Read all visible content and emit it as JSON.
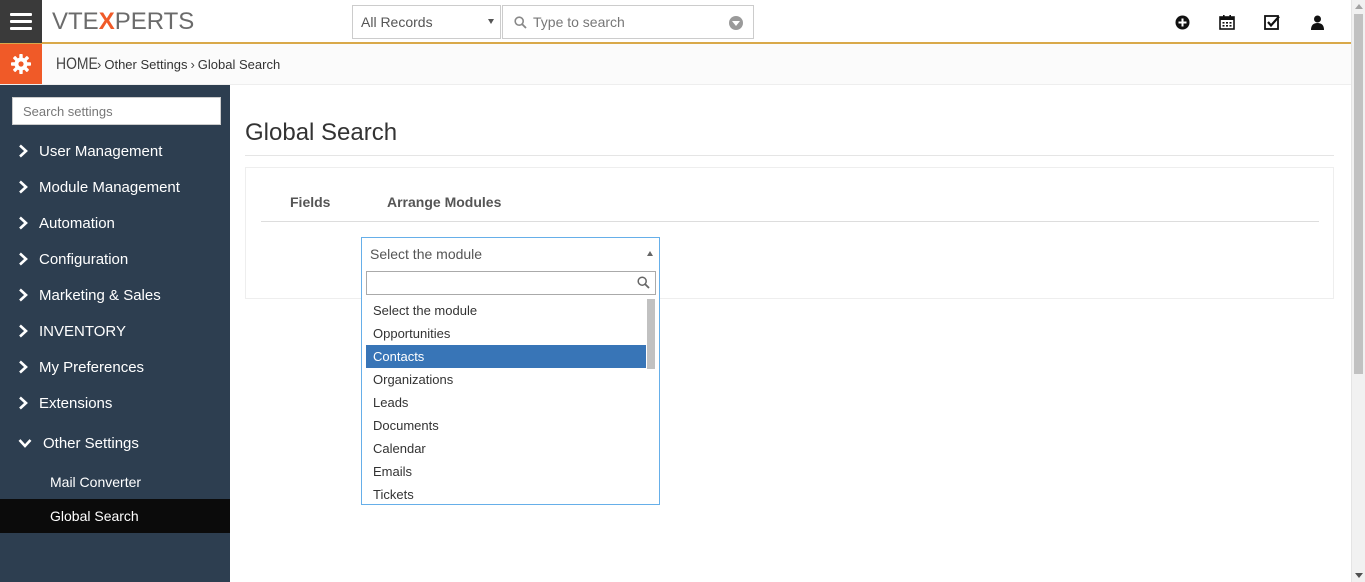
{
  "topbar": {
    "logo": {
      "pre": "VTE",
      "x": "X",
      "post": "PERTS"
    },
    "record_filter": "All Records",
    "search_placeholder": "Type to search",
    "icons": [
      "plus-circle-icon",
      "calendar-icon",
      "task-check-icon",
      "user-icon"
    ]
  },
  "breadcrumb": {
    "home": "HOME",
    "sep1": "›",
    "level1": "Other Settings",
    "sep2": "›",
    "level2": "Global Search"
  },
  "sidebar": {
    "search_placeholder": "Search settings",
    "items": [
      {
        "label": "User Management",
        "expanded": false
      },
      {
        "label": "Module Management",
        "expanded": false
      },
      {
        "label": "Automation",
        "expanded": false
      },
      {
        "label": "Configuration",
        "expanded": false
      },
      {
        "label": "Marketing & Sales",
        "expanded": false
      },
      {
        "label": "INVENTORY",
        "expanded": false
      },
      {
        "label": "My Preferences",
        "expanded": false
      },
      {
        "label": "Extensions",
        "expanded": false
      },
      {
        "label": "Other Settings",
        "expanded": true
      }
    ],
    "subitems": [
      {
        "label": "Mail Converter",
        "active": false
      },
      {
        "label": "Global Search",
        "active": true
      }
    ]
  },
  "main": {
    "title": "Global Search",
    "tabs": [
      {
        "label": "Fields"
      },
      {
        "label": "Arrange Modules"
      }
    ],
    "module_select": {
      "value": "Select the module",
      "search_value": "",
      "options": [
        "Select the module",
        "Opportunities",
        "Contacts",
        "Organizations",
        "Leads",
        "Documents",
        "Calendar",
        "Emails",
        "Tickets"
      ],
      "highlighted": "Contacts"
    }
  },
  "colors": {
    "accent": "#f05a28",
    "sidebar_bg": "#2d3e50",
    "active_item_bg": "#0b0b0b",
    "highlight": "#3875b7",
    "topbar_underline": "#d9a94a"
  }
}
